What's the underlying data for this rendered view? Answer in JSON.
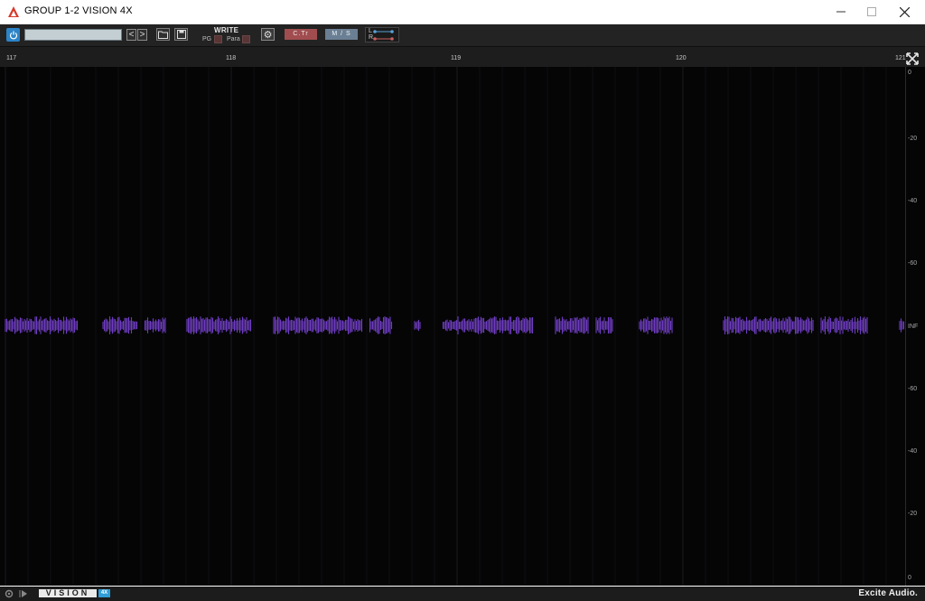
{
  "window": {
    "title": "GROUP 1-2 VISION 4X",
    "minimize_icon": "minimize-icon",
    "maximize_icon": "maximize-icon",
    "close_icon": "close-icon"
  },
  "toolbar": {
    "preset_name": "",
    "prev_label": "<",
    "next_label": ">",
    "write_label": "WRITE",
    "pg_label": "PG",
    "para_label": "Para",
    "ctr_label": "C.Tr",
    "ms_label": "M / S",
    "l_label": "L",
    "r_label": "R",
    "colors": {
      "power": "#2c84c8",
      "ctr": "#a14d4f",
      "ms": "#6b7f94"
    }
  },
  "ruler": {
    "labels": [
      "117",
      "118",
      "119",
      "120",
      "121"
    ]
  },
  "scale": {
    "labels": [
      "0",
      "-20",
      "-40",
      "-60",
      "INF",
      "-60",
      "-40",
      "-20",
      "0"
    ]
  },
  "bottombar": {
    "logo_text": "VISION",
    "version": "4X",
    "brand": "Excite Audio."
  },
  "waveform": {
    "colors": {
      "low": "#7b3fc4",
      "high": "#2fa8b5"
    }
  }
}
